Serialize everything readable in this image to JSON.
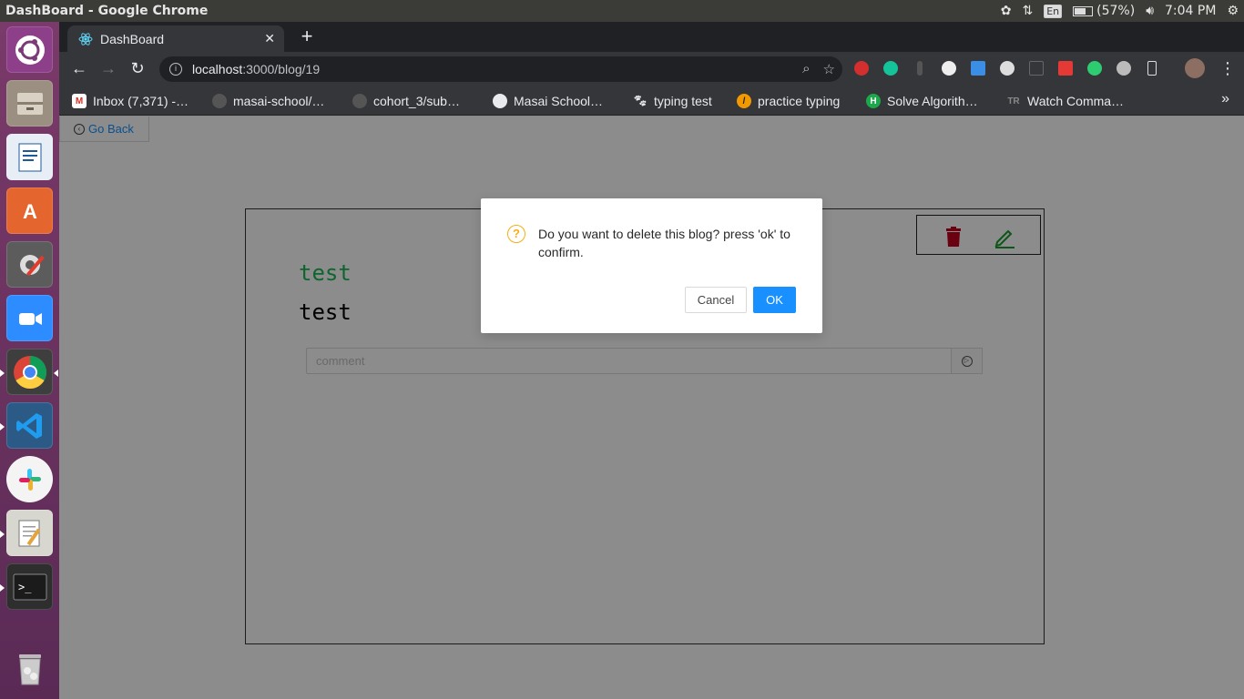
{
  "window": {
    "title": "DashBoard - Google Chrome"
  },
  "tray": {
    "keyboard": "En",
    "battery": "(57%)",
    "battery_level": 0.57,
    "time": "7:04 PM"
  },
  "launcher": {
    "apps": [
      "ubuntu-dash-icon",
      "files-icon",
      "libreoffice-writer-icon",
      "software-center-icon",
      "system-settings-icon",
      "zoom-icon",
      "chrome-icon",
      "vscode-icon",
      "slack-icon",
      "text-editor-icon",
      "terminal-icon",
      "trash-icon"
    ]
  },
  "browser": {
    "tab_title": "DashBoard",
    "url_host": "localhost",
    "url_path": ":3000/blog/19",
    "bookmarks": [
      {
        "label": "Inbox (7,371) -…",
        "icon": "gmail-icon",
        "color": "#d93025"
      },
      {
        "label": "masai-school/…",
        "icon": "github-icon",
        "color": "#222222"
      },
      {
        "label": "cohort_3/sub…",
        "icon": "github-icon",
        "color": "#222222"
      },
      {
        "label": "Masai School…",
        "icon": "globe-icon",
        "color": "#e8eaed"
      },
      {
        "label": "typing test",
        "icon": "paw-icon",
        "color": "#202124"
      },
      {
        "label": "practice typing",
        "icon": "keybr-icon",
        "color": "#f29900"
      },
      {
        "label": "Solve Algorith…",
        "icon": "hackerrank-icon",
        "color": "#1ba94c"
      },
      {
        "label": "Watch Comma…",
        "icon": "tr-icon",
        "color": "#444444"
      }
    ]
  },
  "page": {
    "go_back": "Go Back",
    "blog": {
      "title": "test",
      "body": "test"
    },
    "comment": {
      "placeholder": "comment",
      "value": ""
    }
  },
  "modal": {
    "message": "Do you want to delete this blog? press 'ok' to confirm.",
    "cancel": "Cancel",
    "ok": "OK"
  },
  "colors": {
    "accent": "#1890ff",
    "title_green": "#1db954",
    "delete_red": "#c4001f",
    "edit_green": "#1a9b2c",
    "warning": "#faad14"
  }
}
